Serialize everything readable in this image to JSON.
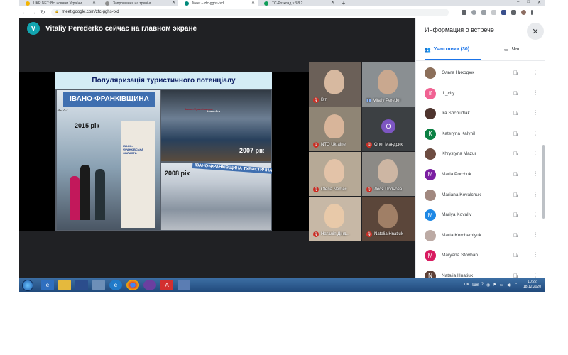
{
  "browser": {
    "tabs": [
      {
        "title": "UKR.NET: Всі новини України, ...",
        "favicon_color": "#f4b400",
        "active": false
      },
      {
        "title": "Запрошення на тренінг",
        "favicon_color": "#8e8e8e",
        "active": false
      },
      {
        "title": "Meet – zfc-gghs-txd",
        "favicon_color": "#00897b",
        "active": true
      },
      {
        "title": "ТС-Розклад v.3.8.2",
        "favicon_color": "#0f9d58",
        "active": false
      }
    ],
    "new_tab": "+",
    "window_controls": {
      "minimize": "–",
      "maximize": "□",
      "close": "✕"
    },
    "url": "meet.google.com/zfc-gghs-txd",
    "nav": {
      "back": "←",
      "forward": "→",
      "reload": "↻"
    }
  },
  "meet": {
    "presenter_initial": "V",
    "presenter_text": "Vitaliy Perederko сейчас на главном экране",
    "slide": {
      "title": "Популяризація туристичного потенціалу",
      "banner": "ІВАНО-ФРАНКІВЩИНА",
      "code": "3G-2-2",
      "stand_text": "ІВАНО-ФРАНКІВСЬКА ОБЛАСТЬ",
      "year_a": "2015 рік",
      "year_b": "2007 рік",
      "year_c": "2008 рік",
      "photo2_text_a": "Івано-Франківщина",
      "photo2_text_b": "Ivano-Fra",
      "photo3_banner": "ІВАНО-ФРАНКІВЩИНА ТУРИСТИЧНА"
    },
    "tiles": [
      {
        "name": "Віт",
        "mic": "off",
        "bg": "#6b6058"
      },
      {
        "name": "Vitaliy Pereder",
        "mic": "live",
        "bg": "#8a8f92"
      },
      {
        "name": "NTO Ukraine",
        "mic": "off",
        "bg": "#8f8575"
      },
      {
        "name": "Олег Мандрик",
        "mic": "off",
        "bg": "#3c4043",
        "avatar": "O"
      },
      {
        "name": "Olena Nemec",
        "mic": "off",
        "bg": "#b6a996"
      },
      {
        "name": "Леся Польова",
        "mic": "off",
        "bg": "#8c8a86"
      },
      {
        "name": "Наталія Дінд...",
        "mic": "off",
        "bg": "#c7b8a6"
      },
      {
        "name": "Natalia Hnatiuk",
        "mic": "off",
        "bg": "#5b463a"
      }
    ]
  },
  "panel": {
    "title": "Информация о встрече",
    "close_icon": "✕",
    "tab_participants": "Участники (30)",
    "tab_chat": "Чат",
    "participants": [
      {
        "name": "Ольга Никодюк",
        "avatar": "",
        "color": "#8c6f5a"
      },
      {
        "name": "if _city",
        "avatar": "if",
        "color": "#f06292"
      },
      {
        "name": "Ira Shchudlak",
        "avatar": "",
        "color": "#4e342e"
      },
      {
        "name": "Kateryna Kalynil",
        "avatar": "K",
        "color": "#0b8043"
      },
      {
        "name": "Khrystyna Mazur",
        "avatar": "",
        "color": "#6d4c41"
      },
      {
        "name": "Maria Porchuk",
        "avatar": "M",
        "color": "#7b1fa2"
      },
      {
        "name": "Mariana Kovalchuk",
        "avatar": "",
        "color": "#a1887f"
      },
      {
        "name": "Mariya Kovaliv",
        "avatar": "M",
        "color": "#1e88e5"
      },
      {
        "name": "Marta Korchemiyuk",
        "avatar": "",
        "color": "#bcaaa4"
      },
      {
        "name": "Maryana Stovban",
        "avatar": "M",
        "color": "#d81b60"
      },
      {
        "name": "Natalia Hnatiuk",
        "avatar": "N",
        "color": "#5d4037"
      }
    ]
  },
  "taskbar": {
    "language": "UK",
    "time": "10:22",
    "date": "18.12.2020"
  }
}
